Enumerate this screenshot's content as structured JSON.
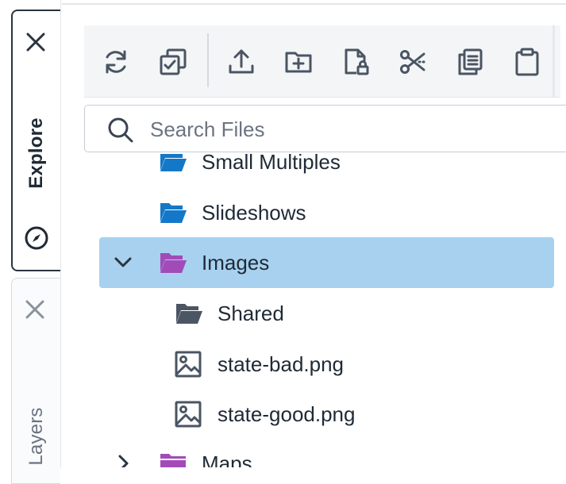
{
  "panel_tabs": [
    {
      "label": "Explore",
      "close_label": "Close Explore panel",
      "active": true
    },
    {
      "label": "Layers",
      "close_label": "Close Layers panel",
      "active": false
    }
  ],
  "toolbar": {
    "buttons": [
      {
        "name": "refresh-icon",
        "title": "Refresh"
      },
      {
        "name": "select-multiple-icon",
        "title": "Select Multiple"
      },
      {
        "name": "upload-icon",
        "title": "Upload"
      },
      {
        "name": "new-folder-icon",
        "title": "New Folder"
      },
      {
        "name": "file-permissions-icon",
        "title": "Permissions"
      },
      {
        "name": "cut-icon",
        "title": "Cut"
      },
      {
        "name": "copy-icon",
        "title": "Copy"
      },
      {
        "name": "paste-icon",
        "title": "Paste"
      }
    ]
  },
  "search": {
    "placeholder": "Search Files",
    "value": ""
  },
  "tree": {
    "items": [
      {
        "label": "Small Multiples",
        "type": "folder",
        "color": "#1478c8",
        "depth": 0
      },
      {
        "label": "Slideshows",
        "type": "folder",
        "color": "#1478c8",
        "depth": 0
      },
      {
        "label": "Images",
        "type": "folder",
        "color": "#a24bb8",
        "depth": 0,
        "expanded": true,
        "selected": true
      },
      {
        "label": "Shared",
        "type": "folder",
        "color": "#4c5563",
        "depth": 1
      },
      {
        "label": "state-bad.png",
        "type": "image",
        "depth": 1
      },
      {
        "label": "state-good.png",
        "type": "image",
        "depth": 1
      },
      {
        "label": "Maps",
        "type": "folder",
        "color": "#a24bb8",
        "depth": 0,
        "expanded": false
      }
    ]
  },
  "colors": {
    "selection": "#a7d1ef",
    "blue_folder": "#1478c8",
    "purple_folder": "#a24bb8",
    "gray_folder": "#4c5563",
    "icon": "#4a5563"
  }
}
